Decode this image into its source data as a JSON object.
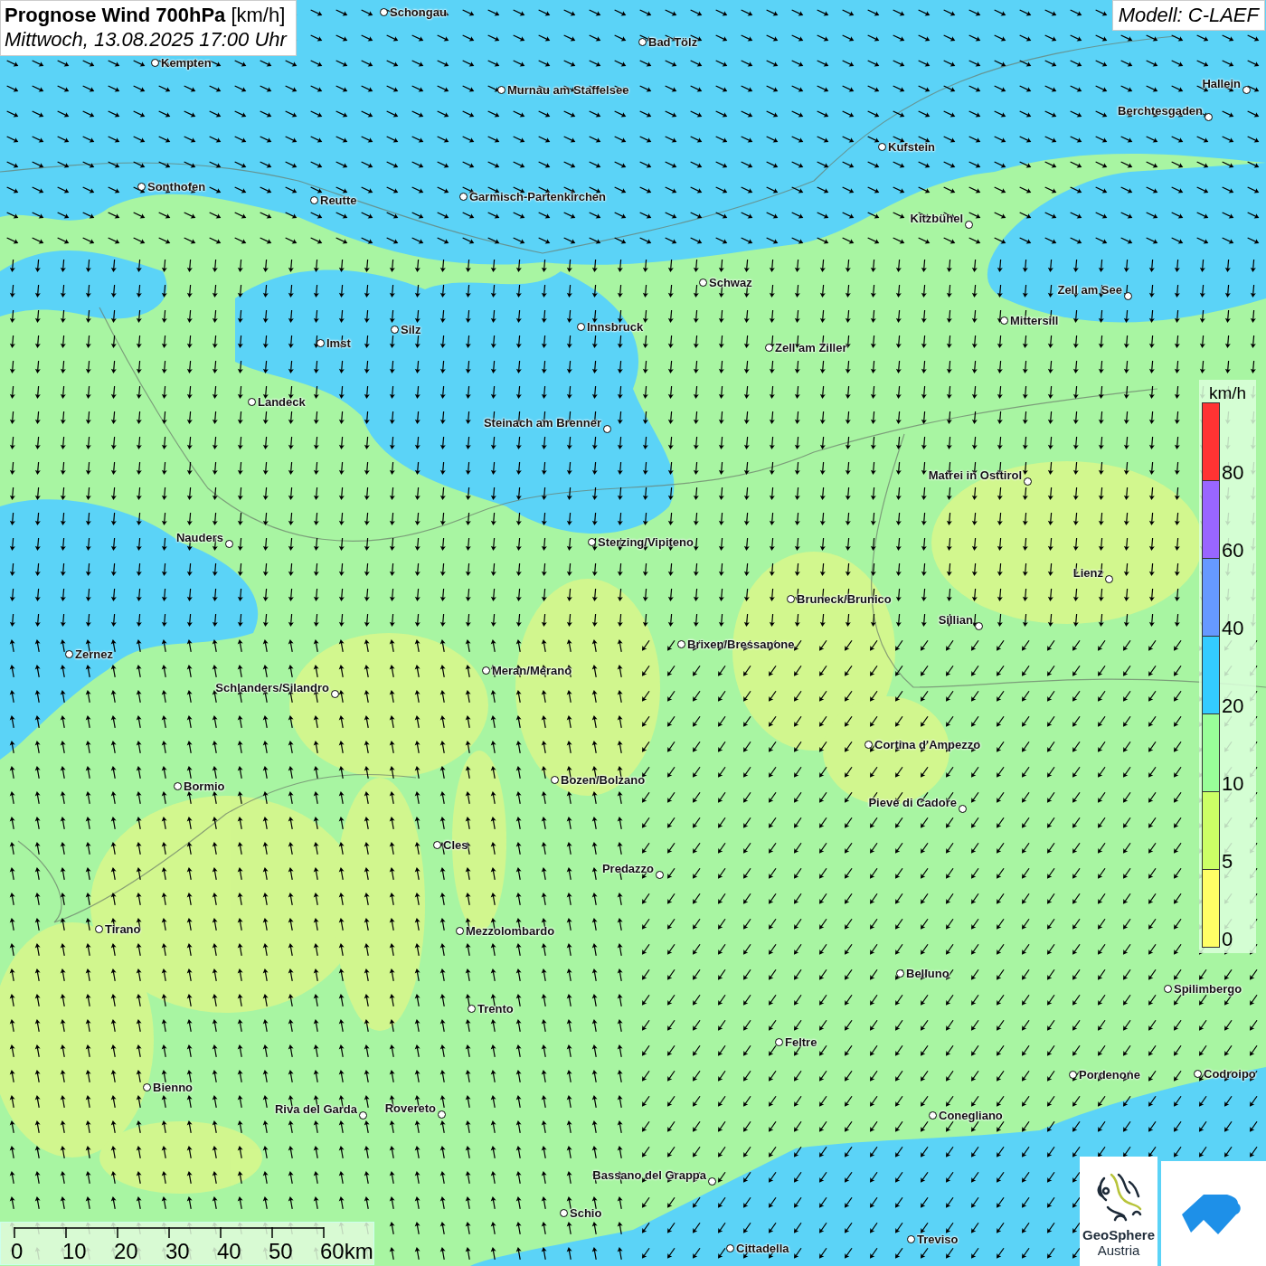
{
  "title": {
    "main": "Prognose Wind 700hPa",
    "unit": "[km/h]",
    "datetime": "Mittwoch, 13.08.2025 17:00 Uhr"
  },
  "model": "Modell: C-LAEF",
  "cities": [
    {
      "name": "Schongau"
    },
    {
      "name": "Bad Tölz"
    },
    {
      "name": "Kempten"
    },
    {
      "name": "Murnau am Staffelsee"
    },
    {
      "name": "Hallein"
    },
    {
      "name": "Berchtesgaden"
    },
    {
      "name": "Kufstein"
    },
    {
      "name": "Sonthofen"
    },
    {
      "name": "Reutte"
    },
    {
      "name": "Garmisch-Partenkirchen"
    },
    {
      "name": "Kitzbühel"
    },
    {
      "name": "Schwaz"
    },
    {
      "name": "Zell am See"
    },
    {
      "name": "Mittersill"
    },
    {
      "name": "Innsbruck"
    },
    {
      "name": "Silz"
    },
    {
      "name": "Imst"
    },
    {
      "name": "Zell am Ziller"
    },
    {
      "name": "Landeck"
    },
    {
      "name": "Steinach am Brenner"
    },
    {
      "name": "Matrei in Osttirol"
    },
    {
      "name": "Nauders"
    },
    {
      "name": "Sterzing/Vipiteno"
    },
    {
      "name": "Lienz"
    },
    {
      "name": "Bruneck/Brunico"
    },
    {
      "name": "Sillian"
    },
    {
      "name": "Brixen/Bressanone"
    },
    {
      "name": "Zernez"
    },
    {
      "name": "Meran/Merano"
    },
    {
      "name": "Schlanders/Silandro"
    },
    {
      "name": "Cortina d'Ampezzo"
    },
    {
      "name": "Bozen/Bolzano"
    },
    {
      "name": "Bormio"
    },
    {
      "name": "Pieve di Cadore"
    },
    {
      "name": "Cles"
    },
    {
      "name": "Predazzo"
    },
    {
      "name": "Tirano"
    },
    {
      "name": "Mezzolombardo"
    },
    {
      "name": "Belluno"
    },
    {
      "name": "Spilimbergo"
    },
    {
      "name": "Trento"
    },
    {
      "name": "Feltre"
    },
    {
      "name": "Pordenone"
    },
    {
      "name": "Codroipo"
    },
    {
      "name": "Bienno"
    },
    {
      "name": "Riva del Garda"
    },
    {
      "name": "Rovereto"
    },
    {
      "name": "Conegliano"
    },
    {
      "name": "Bassano del Grappa"
    },
    {
      "name": "Schio"
    },
    {
      "name": "Treviso"
    },
    {
      "name": "Cittadella"
    }
  ],
  "legend": {
    "unit": "km/h",
    "items": [
      {
        "label": "80",
        "color": "#ff3333"
      },
      {
        "label": "60",
        "color": "#9966ff"
      },
      {
        "label": "40",
        "color": "#6699ff"
      },
      {
        "label": "20",
        "color": "#33ccff"
      },
      {
        "label": "10",
        "color": "#99ff99"
      },
      {
        "label": "5",
        "color": "#ccff66"
      },
      {
        "label": "0",
        "color": "#ffff66"
      }
    ]
  },
  "scale_bar": {
    "ticks": [
      "0",
      "10",
      "20",
      "30",
      "40",
      "50",
      "60km"
    ]
  },
  "logo": {
    "name": "GeoSphere",
    "subtitle": "Austria"
  }
}
